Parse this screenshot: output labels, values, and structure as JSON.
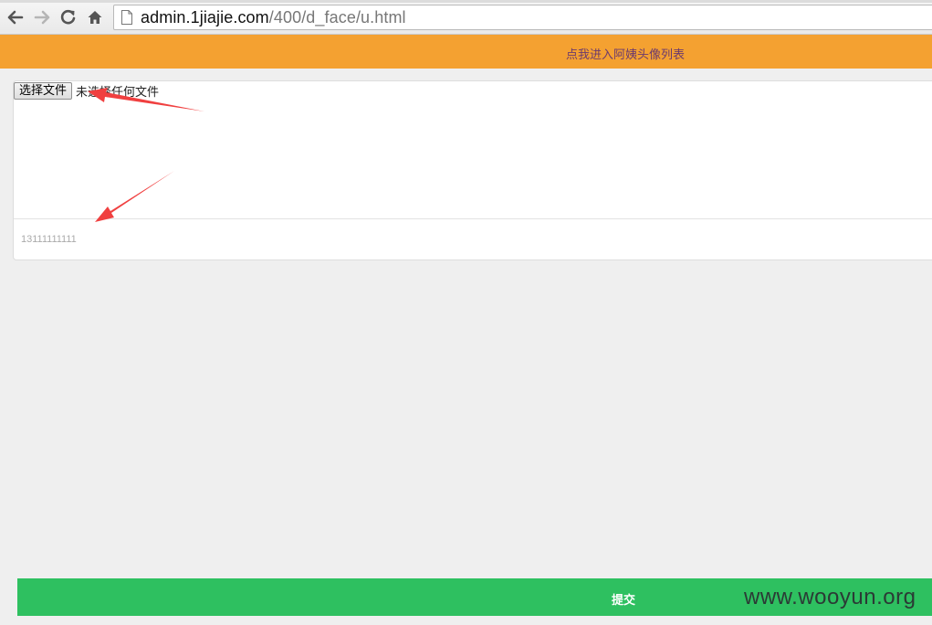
{
  "browser": {
    "url_host": "admin.1jiajie.com",
    "url_path": "/400/d_face/u.html"
  },
  "header": {
    "link_text": "点我进入阿姨头像列表",
    "background": "#f4a131",
    "link_color": "#6b3a6e"
  },
  "form": {
    "file_button_label": "选择文件",
    "file_status": "未选择任何文件",
    "phone_value": "13111111111"
  },
  "submit": {
    "label": "提交",
    "color": "#2ec060"
  },
  "watermark": {
    "text": "www.wooyun.org"
  },
  "annotation": {
    "arrow_color": "#f04040"
  }
}
